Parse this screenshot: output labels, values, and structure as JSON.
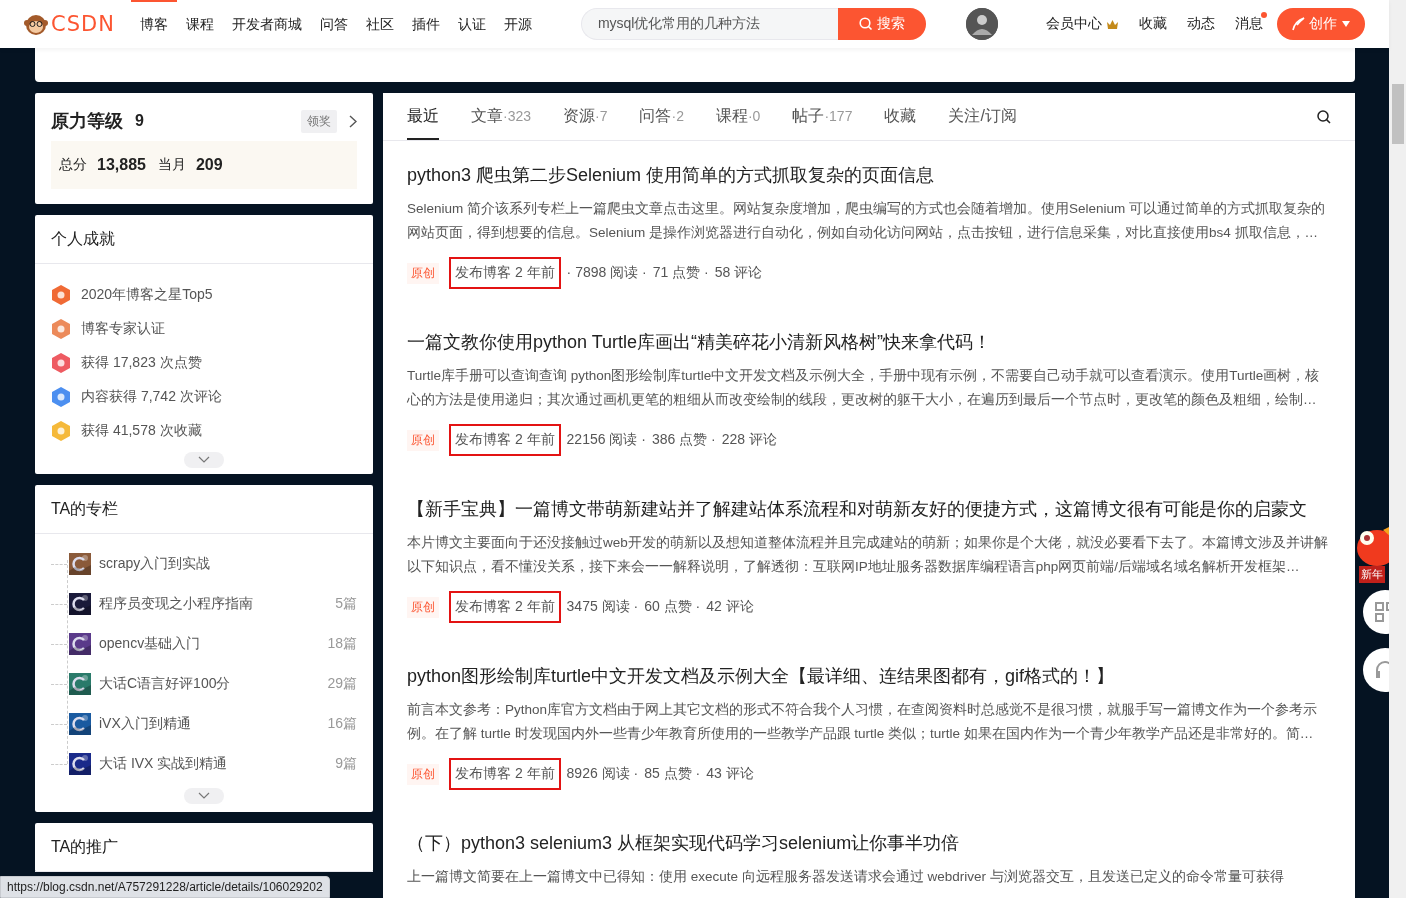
{
  "header": {
    "logo": "CSDN",
    "nav": [
      {
        "label": "博客",
        "selected": true
      },
      {
        "label": "课程",
        "selected": false
      },
      {
        "label": "开发者商城",
        "selected": false
      },
      {
        "label": "问答",
        "selected": false
      },
      {
        "label": "社区",
        "selected": false
      },
      {
        "label": "插件",
        "selected": false
      },
      {
        "label": "认证",
        "selected": false
      },
      {
        "label": "开源",
        "selected": false
      }
    ],
    "search": {
      "value": "mysql优化常用的几种方法",
      "button": "搜索"
    },
    "links": [
      {
        "label": "会员中心",
        "kind": "vip",
        "badge": false
      },
      {
        "label": "收藏",
        "kind": "plain",
        "badge": false
      },
      {
        "label": "动态",
        "kind": "plain",
        "badge": false
      },
      {
        "label": "消息",
        "kind": "plain",
        "badge": true
      }
    ],
    "create": "创作"
  },
  "level_card": {
    "title": "原力等级",
    "level": "9",
    "claim": "领奖",
    "total_label": "总分",
    "total": "13,885",
    "month_label": "当月",
    "month": "209"
  },
  "achievements": {
    "title": "个人成就",
    "items": [
      {
        "text": "2020年博客之星Top5",
        "color": "#f06a35"
      },
      {
        "text": "博客专家认证",
        "color": "#ec8a5a"
      },
      {
        "text": "获得 17,823 次点赞",
        "color": "#ee5b62"
      },
      {
        "text": "内容获得 7,742 次评论",
        "color": "#4c8ff0"
      },
      {
        "text": "获得 41,578 次收藏",
        "color": "#f5b93a"
      }
    ]
  },
  "columns": {
    "title": "TA的专栏",
    "items": [
      {
        "name": "scrapy入门到实战",
        "color": "#8a5a3a"
      },
      {
        "name": "程序员变现之小程序指南",
        "count": "5篇",
        "color": "#1a1a3a"
      },
      {
        "name": "opencv基础入门",
        "count": "18篇",
        "color": "#5a3a8a"
      },
      {
        "name": "大话C语言好评100分",
        "count": "29篇",
        "color": "#2a7a6a"
      },
      {
        "name": "iVX入门到精通",
        "count": "16篇",
        "color": "#1a5aa0"
      },
      {
        "name": "大话 IVX 实战到精通",
        "count": "9篇",
        "color": "#1a2a8a"
      }
    ]
  },
  "promo": {
    "title": "TA的推广"
  },
  "tabs": [
    {
      "label": "最近",
      "selected": true
    },
    {
      "label": "文章",
      "count": "·323",
      "selected": false
    },
    {
      "label": "资源",
      "count": "·7",
      "selected": false
    },
    {
      "label": "问答",
      "count": "·2",
      "selected": false
    },
    {
      "label": "课程",
      "count": "·0",
      "selected": false
    },
    {
      "label": "帖子",
      "count": "·177",
      "selected": false
    },
    {
      "label": "收藏",
      "selected": false
    },
    {
      "label": "关注/订阅",
      "selected": false
    }
  ],
  "articles": [
    {
      "title": "python3 爬虫第二步Selenium 使用简单的方式抓取复杂的页面信息",
      "summary": "Selenium 简介该系列专栏上一篇爬虫文章点击这里。网站复杂度增加，爬虫编写的方式也会随着增加。使用Selenium 可以通过简单的方式抓取复杂的网站页面，得到想要的信息。Selenium 是操作浏览器进行自动化，例如自动化访问网站，点击按钮，进行信息采集，对比直接使用bs4 抓取信息，…",
      "tag": "原创",
      "date": "发布博客 2 年前",
      "reads": "· 7898 阅读 ·",
      "likes": "71 点赞 ·",
      "comments": "58 评论"
    },
    {
      "title": "一篇文教你使用python Turtle库画出“精美碎花小清新风格树”快来拿代码！",
      "summary": "Turtle库手册可以查询查询 python图形绘制库turtle中文开发文档及示例大全，手册中现有示例，不需要自己动手就可以查看演示。使用Turtle画树，核心的方法是使用递归；其次通过画机更笔的粗细从而改变绘制的线段，更改树的躯干大小，在遍历到最后一个节点时，更改笔的颜色及粗细，绘制…",
      "tag": "原创",
      "date": "发布博客 2 年前",
      "reads": "22156 阅读 ·",
      "likes": "386 点赞 ·",
      "comments": "228 评论"
    },
    {
      "title": "【新手宝典】一篇博文带萌新建站并了解建站体系流程和对萌新友好的便捷方式，这篇博文很有可能是你的启蒙文",
      "summary": "本片博文主要面向于还没接触过web开发的萌新以及想知道整体流程并且完成建站的萌新；如果你是个大佬，就没必要看下去了。本篇博文涉及并讲解以下知识点，看不懂没关系，接下来会一一解释说明，了解透彻：互联网IP地址服务器数据库编程语言php网页前端/后端域名域名解析开发框架…",
      "tag": "原创",
      "date": "发布博客 2 年前",
      "reads": "3475 阅读 ·",
      "likes": "60 点赞 ·",
      "comments": "42 评论"
    },
    {
      "title": "python图形绘制库turtle中文开发文档及示例大全【最详细、连结果图都有，gif格式的！】",
      "summary": "前言本文参考：Python库官方文档由于网上其它文档的形式不符合我个人习惯，在查阅资料时总感觉不是很习惯，就服手写一篇博文作为一个参考示例。在了解 turtle 时发现国内外一些青少年教育所使用的一些教学产品跟 turtle 类似；turtle 如果在国内作为一个青少年教学产品还是非常好的。简…",
      "tag": "原创",
      "date": "发布博客 2 年前",
      "reads": "8926 阅读 ·",
      "likes": "85 点赞 ·",
      "comments": "43 评论"
    },
    {
      "title": "（下）python3 selenium3 从框架实现代码学习selenium让你事半功倍",
      "summary": "上一篇博文简要在上一篇博文中已得知：使用 execute 向远程服务器发送请求会通过 webdriver 与浏览器交互，且发送已定义的命令常量可获得"
    }
  ],
  "float_widget": {
    "label": "新年"
  },
  "status_url": "https://blog.csdn.net/A757291228/article/details/106029202"
}
